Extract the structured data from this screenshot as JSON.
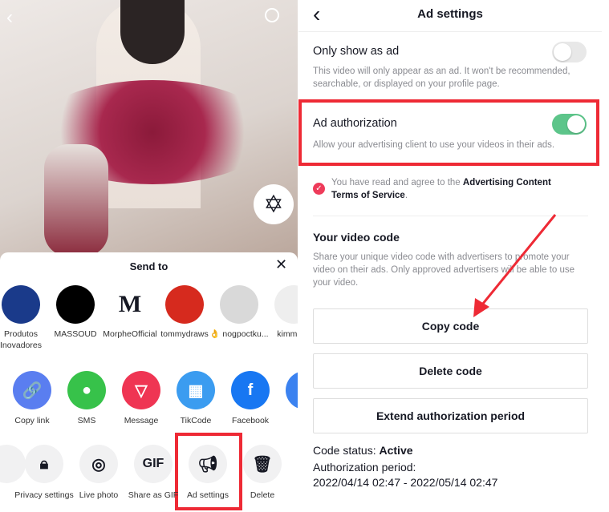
{
  "left": {
    "send_to": "Send to",
    "contacts": [
      {
        "name": "Produtos Inovadores",
        "color": "#1a3a8a"
      },
      {
        "name": "MASSOUD",
        "color": "#000000"
      },
      {
        "name": "MorpheOfficial",
        "color": "#ffffff",
        "verified": true
      },
      {
        "name": "tommydraws",
        "color": "#d62a1e"
      },
      {
        "name": "👌 nogpoctku...",
        "color": "#d9d9d9"
      },
      {
        "name": "kimmie s",
        "color": "#eeeeee"
      }
    ],
    "share": [
      {
        "label": "Copy link",
        "icon": "link-icon",
        "color": "#5a7ef0"
      },
      {
        "label": "SMS",
        "icon": "chat-bubble-icon",
        "color": "#37c24a"
      },
      {
        "label": "Message",
        "icon": "send-icon",
        "color": "#ef3553"
      },
      {
        "label": "TikCode",
        "icon": "qr-code-icon",
        "color": "#3b9cf0"
      },
      {
        "label": "Facebook",
        "icon": "facebook-icon",
        "color": "#1877f2"
      }
    ],
    "actions": [
      {
        "label": "Privacy settings",
        "icon": "lock-icon"
      },
      {
        "label": "Live photo",
        "icon": "live-photo-icon"
      },
      {
        "label": "Share as GIF",
        "icon": "gif-icon",
        "glyph": "GIF"
      },
      {
        "label": "Ad settings",
        "icon": "megaphone-icon"
      },
      {
        "label": "Delete",
        "icon": "trash-icon"
      }
    ]
  },
  "right": {
    "title": "Ad settings",
    "only_ad": {
      "label": "Only show as ad",
      "desc": "This video will only appear as an ad. It won't be recommended, searchable, or displayed on your profile page.",
      "on": false
    },
    "ad_auth": {
      "label": "Ad authorization",
      "desc": "Allow your advertising client to use your videos in their ads.",
      "on": true
    },
    "agree_text": "You have read and agree to the ",
    "agree_link": "Advertising Content Terms of Service",
    "agree_end": ".",
    "video_code_title": "Your video code",
    "video_code_desc": "Share your unique video code with advertisers to promote your video on their ads. Only approved advertisers will be able to use your video.",
    "buttons": [
      "Copy code",
      "Delete code",
      "Extend authorization period"
    ],
    "status_label": "Code status: ",
    "status_value": "Active",
    "period_label": "Authorization period:",
    "period_value": "2022/04/14 02:47 - 2022/05/14 02:47"
  },
  "colors": {
    "accent_green": "#5dc58a",
    "highlight_red": "#ee2a35",
    "tiktok_red": "#fe2c55"
  }
}
